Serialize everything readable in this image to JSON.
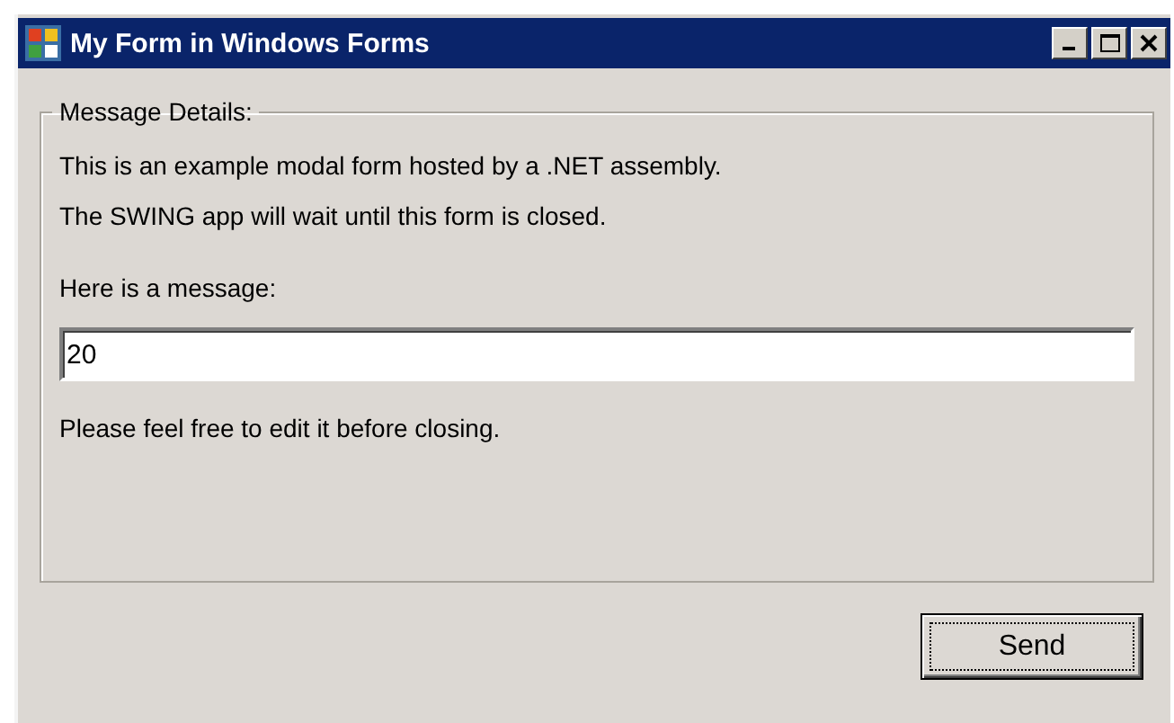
{
  "window": {
    "title": "My Form in Windows Forms"
  },
  "group": {
    "title": "Message Details:",
    "lines": [
      "This is an example modal form hosted by a .NET assembly.",
      "The SWING app will wait until this form is closed."
    ],
    "prompt": "Here is a message:",
    "message": {
      "value": "20"
    },
    "note": "Please feel free to edit it before closing."
  },
  "buttons": [
    {
      "label": "Send",
      "focused": true
    }
  ]
}
